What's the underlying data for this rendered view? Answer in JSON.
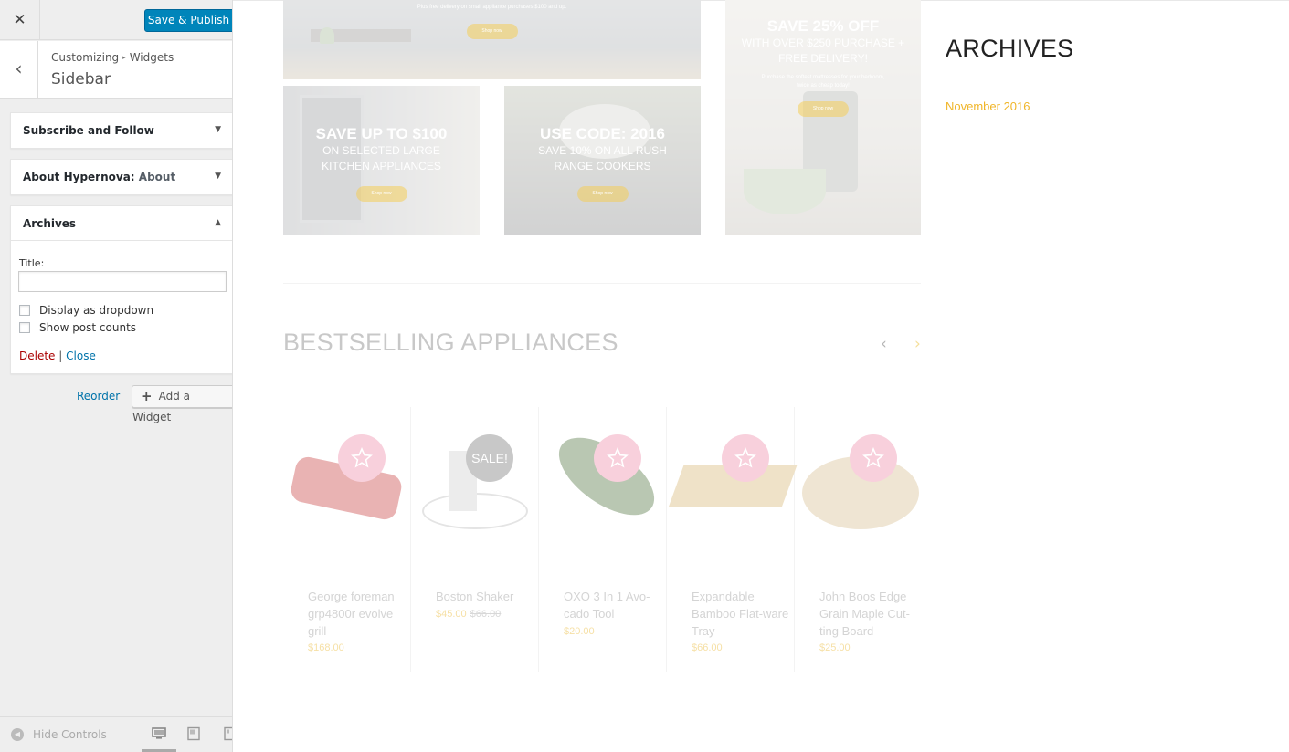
{
  "topbar": {
    "close_glyph": "✕",
    "publish_label": "Save & Publish"
  },
  "section": {
    "back_glyph": "‹",
    "breadcrumb_root": "Customizing",
    "breadcrumb_sep": "▸",
    "breadcrumb_current": "Widgets",
    "title": "Sidebar"
  },
  "widgets": [
    {
      "title": "Subscribe and Follow",
      "in_widget_title": "",
      "arrow": "▼",
      "expanded": false
    },
    {
      "title": "About Hypernova",
      "in_widget_title": "About",
      "arrow": "▼",
      "expanded": false
    },
    {
      "title": "Archives",
      "in_widget_title": "",
      "arrow": "▲",
      "expanded": true
    }
  ],
  "about_sep": ":",
  "archives_form": {
    "title_label": "Title:",
    "title_value": "",
    "display_dropdown_label": "Display as dropdown",
    "display_dropdown_checked": false,
    "show_counts_label": "Show post counts",
    "show_counts_checked": false,
    "delete_label": "Delete",
    "action_sep": "|",
    "close_label": "Close"
  },
  "sidebar_actions": {
    "reorder_label": "Reorder",
    "add_widget_label": "Add a Widget",
    "add_widget_glyph": "+"
  },
  "footer": {
    "hide_controls_label": "Hide Controls",
    "devices": [
      "desktop-icon",
      "tablet-icon",
      "mobile-icon"
    ],
    "active_device": "desktop"
  },
  "preview": {
    "banner_top_small": "Plus free delivery on small appliance purchases $100 and up.",
    "banners": [
      {
        "headline": "SAVE UP TO $100",
        "sub": "ON SELECTED LARGE KITCHEN APPLIANCES"
      },
      {
        "headline": "USE CODE: 2016",
        "sub": "SAVE 10% ON ALL RUSH RANGE COOKERS"
      },
      {
        "headline": "SAVE 25% OFF",
        "sub": "WITH OVER $250 PURCHASE + FREE DELIVERY!",
        "small": "Purchase the softest mattresses for your bedroom, twice as cheap today!"
      }
    ],
    "shop_now": "Shop now",
    "bestselling_title": "BESTSELLING APPLIANCES",
    "prev_glyph": "‹",
    "next_glyph": "›",
    "sale_badge": "SALE!",
    "products": [
      {
        "name": "George foreman grp4800r evolve grill",
        "price": "$168.00",
        "old_price": ""
      },
      {
        "name": "Boston Shaker",
        "price": "$45.00",
        "old_price": "$66.00"
      },
      {
        "name": "OXO 3 In 1 Avo-cado Tool",
        "price": "$20.00",
        "old_price": ""
      },
      {
        "name": "Expandable Bamboo Flat-ware Tray",
        "price": "$66.00",
        "old_price": ""
      },
      {
        "name": "John Boos Edge Grain Maple Cut-ting Board",
        "price": "$25.00",
        "old_price": ""
      }
    ],
    "archives_heading": "ARCHIVES",
    "archive_item": "November 2016"
  },
  "colors": {
    "accent": "#0085ba",
    "link": "#0073aa",
    "delete": "#aa0000",
    "archive_link": "#f0b528"
  }
}
